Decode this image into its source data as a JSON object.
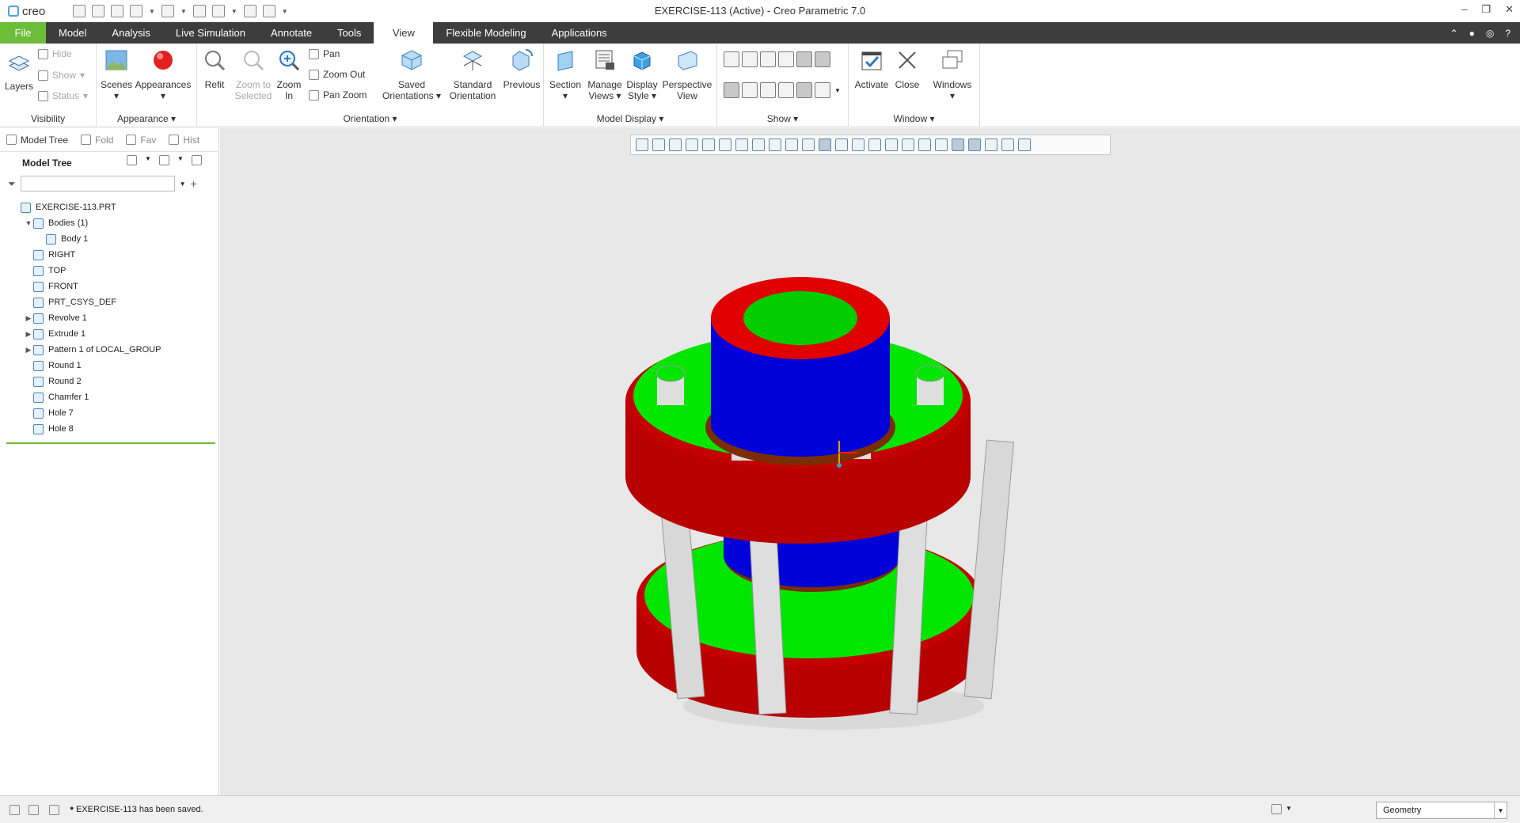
{
  "window": {
    "app_logo": "creo",
    "title": "EXERCISE-113 (Active) - Creo Parametric 7.0",
    "controls": [
      "–",
      "❐",
      "✕"
    ]
  },
  "menu": {
    "tabs": [
      "File",
      "Model",
      "Analysis",
      "Live Simulation",
      "Annotate",
      "Tools",
      "View",
      "Flexible Modeling",
      "Applications"
    ],
    "active_tab": "View"
  },
  "ribbon": {
    "visibility": {
      "label": "Visibility",
      "layers": "Layers",
      "hide": "Hide",
      "show": "Show",
      "status": "Status"
    },
    "appearance": {
      "label": "Appearance",
      "scenes": "Scenes",
      "appearances": "Appearances"
    },
    "orientation": {
      "label": "Orientation",
      "refit": "Refit",
      "zoom_selected_1": "Zoom to",
      "zoom_selected_2": "Selected",
      "zoom_in_1": "Zoom",
      "zoom_in_2": "In",
      "pan": "Pan",
      "zoom_out": "Zoom Out",
      "pan_zoom": "Pan Zoom",
      "saved_1": "Saved",
      "saved_2": "Orientations",
      "standard_1": "Standard",
      "standard_2": "Orientation",
      "previous": "Previous"
    },
    "model_display": {
      "label": "Model Display",
      "section": "Section",
      "manage_1": "Manage",
      "manage_2": "Views",
      "style_1": "Display",
      "style_2": "Style",
      "persp_1": "Perspective",
      "persp_2": "View"
    },
    "show": {
      "label": "Show"
    },
    "window": {
      "label": "Window",
      "activate": "Activate",
      "close": "Close",
      "windows": "Windows"
    }
  },
  "panel": {
    "tabs": [
      "Model Tree",
      "Fold",
      "Fav",
      "Hist"
    ],
    "title": "Model Tree",
    "filter_placeholder": ""
  },
  "tree": [
    {
      "label": "EXERCISE-113.PRT",
      "level": 0,
      "twisty": ""
    },
    {
      "label": "Bodies (1)",
      "level": 1,
      "twisty": "▼"
    },
    {
      "label": "Body 1",
      "level": 2,
      "twisty": ""
    },
    {
      "label": "RIGHT",
      "level": 1,
      "twisty": ""
    },
    {
      "label": "TOP",
      "level": 1,
      "twisty": ""
    },
    {
      "label": "FRONT",
      "level": 1,
      "twisty": ""
    },
    {
      "label": "PRT_CSYS_DEF",
      "level": 1,
      "twisty": ""
    },
    {
      "label": "Revolve 1",
      "level": 1,
      "twisty": "▶"
    },
    {
      "label": "Extrude 1",
      "level": 1,
      "twisty": "▶"
    },
    {
      "label": "Pattern 1 of LOCAL_GROUP",
      "level": 1,
      "twisty": "▶"
    },
    {
      "label": "Round 1",
      "level": 1,
      "twisty": ""
    },
    {
      "label": "Round 2",
      "level": 1,
      "twisty": ""
    },
    {
      "label": "Chamfer 1",
      "level": 1,
      "twisty": ""
    },
    {
      "label": "Hole 7",
      "level": 1,
      "twisty": ""
    },
    {
      "label": "Hole 8",
      "level": 1,
      "twisty": ""
    }
  ],
  "status": {
    "message": "EXERCISE-113 has been saved.",
    "selection_filter": "Geometry"
  },
  "colors": {
    "file_tab": "#6cbd3a",
    "menubar": "#3d3d3d",
    "model_red": "#c40000",
    "model_green": "#00e600",
    "model_blue": "#0000d8",
    "model_rod": "#d8d8d8"
  }
}
